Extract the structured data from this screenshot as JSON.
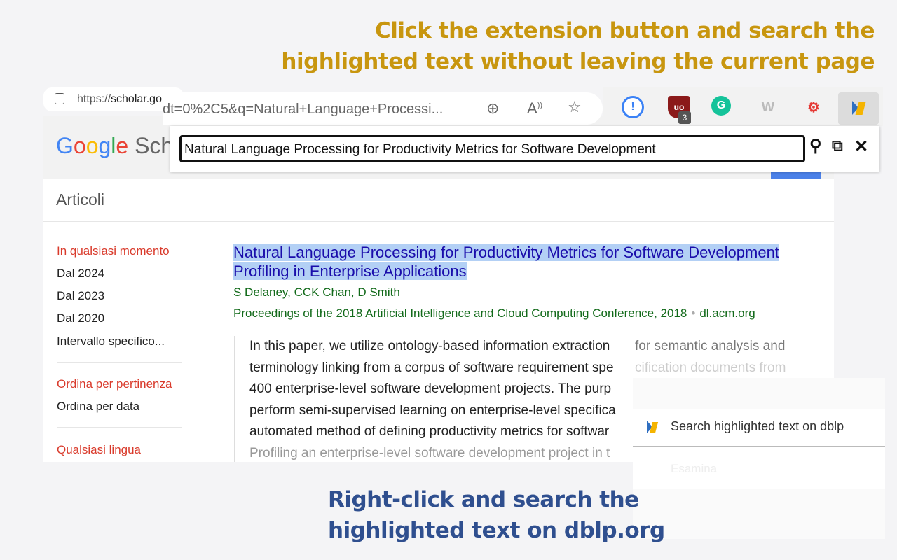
{
  "headline": {
    "line1": "Click the extension button and search the",
    "line2": "highlighted text without leaving the current page",
    "color": "#c8960f"
  },
  "caption": {
    "line1": "Right-click and search the",
    "line2": "highlighted text on dblp.org",
    "color": "#2f4f8f"
  },
  "browser": {
    "url_prefix": "https://",
    "url_host": "scholar.go",
    "url_overlay": "dt=0%2C5&q=Natural+Language+Processi...",
    "toolbar_icons": [
      "zoom-in-icon",
      "read-aloud-icon",
      "star-icon"
    ],
    "extensions": [
      {
        "name": "password-manager-icon",
        "color": "#3b82f6"
      },
      {
        "name": "ublock-icon",
        "color": "#8b1a1a",
        "badge": "3"
      },
      {
        "name": "grammarly-icon",
        "color": "#15c39a"
      },
      {
        "name": "w-extension-icon",
        "color": "#bbbbbb"
      },
      {
        "name": "search-gear-icon",
        "color": "#e53935"
      },
      {
        "name": "dblp-icon",
        "color": "#f5b400"
      }
    ]
  },
  "popup": {
    "search_value": "Natural Language Processing for Productivity Metrics for Software Development",
    "icons": [
      "search-icon",
      "open-external-icon",
      "close-icon"
    ]
  },
  "scholar": {
    "logo": {
      "G": "G",
      "o1": "o",
      "o2": "o",
      "g": "g",
      "l": "l",
      "e": "e",
      "rest": " Sch"
    },
    "section": "Articoli",
    "sidebar": [
      {
        "label": "In qualsiasi momento",
        "active": true
      },
      {
        "label": "Dal 2024"
      },
      {
        "label": "Dal 2023"
      },
      {
        "label": "Dal 2020"
      },
      {
        "label": "Intervallo specifico..."
      },
      {
        "label": "Ordina per pertinenza",
        "active": true
      },
      {
        "label": "Ordina per data"
      },
      {
        "label": "Qualsiasi lingua",
        "active": true
      }
    ],
    "result": {
      "title_line1": "Natural Language Processing for Productivity Metrics for Software Development",
      "title_line2": "Profiling in Enterprise Applications",
      "authors": "S Delaney, CCK Chan, D Smith",
      "venue": "Proceedings of the 2018 Artificial Intelligence and Cloud Computing Conference, 2018",
      "source": "dl.acm.org",
      "abstract_lines": [
        "In this paper, we utilize ontology-based information extraction",
        "terminology linking from a corpus of software requirement spe",
        "400 enterprise-level software development projects. The purp",
        "perform semi-supervised learning on enterprise-level specifica",
        "automated method of defining productivity metrics for softwar",
        "Profiling an enterprise-level software development project in t"
      ],
      "abstract_overflow": [
        "for semantic analysis and",
        "cification documents from"
      ]
    }
  },
  "context_menu": {
    "item": "Search highlighted text on dblp",
    "faded_item": "Esamina"
  }
}
